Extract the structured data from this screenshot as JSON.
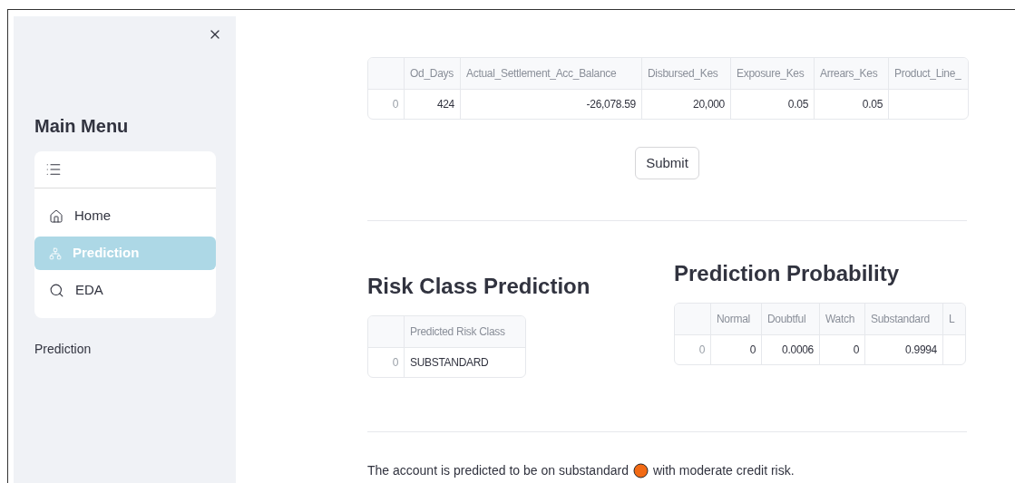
{
  "sidebar": {
    "title": "Main Menu",
    "menu": [
      {
        "label": "Home",
        "selected": false
      },
      {
        "label": "Prediction",
        "selected": true
      },
      {
        "label": "EDA",
        "selected": false
      }
    ],
    "page_label_text": "Prediction"
  },
  "input_table": {
    "columns": [
      "",
      "Od_Days",
      "Actual_Settlement_Acc_Balance",
      "Disbursed_Kes",
      "Exposure_Kes",
      "Arrears_Kes",
      "Product_Line_"
    ],
    "rows": [
      [
        "0",
        "424",
        "-26,078.59",
        "20,000",
        "0.05",
        "0.05",
        ""
      ]
    ]
  },
  "submit_button": "Submit",
  "risk": {
    "title": "Risk Class Prediction",
    "columns": [
      "",
      "Predicted Risk Class"
    ],
    "rows": [
      [
        "0",
        "SUBSTANDARD"
      ]
    ]
  },
  "probability": {
    "title": "Prediction Probability",
    "columns": [
      "",
      "Normal",
      "Doubtful",
      "Watch",
      "Substandard",
      "L"
    ],
    "rows": [
      [
        "0",
        "0",
        "0.0006",
        "0",
        "0.9994",
        ""
      ]
    ]
  },
  "result": {
    "text_before": "The account is predicted to be on substandard",
    "text_after": "with moderate credit risk."
  }
}
